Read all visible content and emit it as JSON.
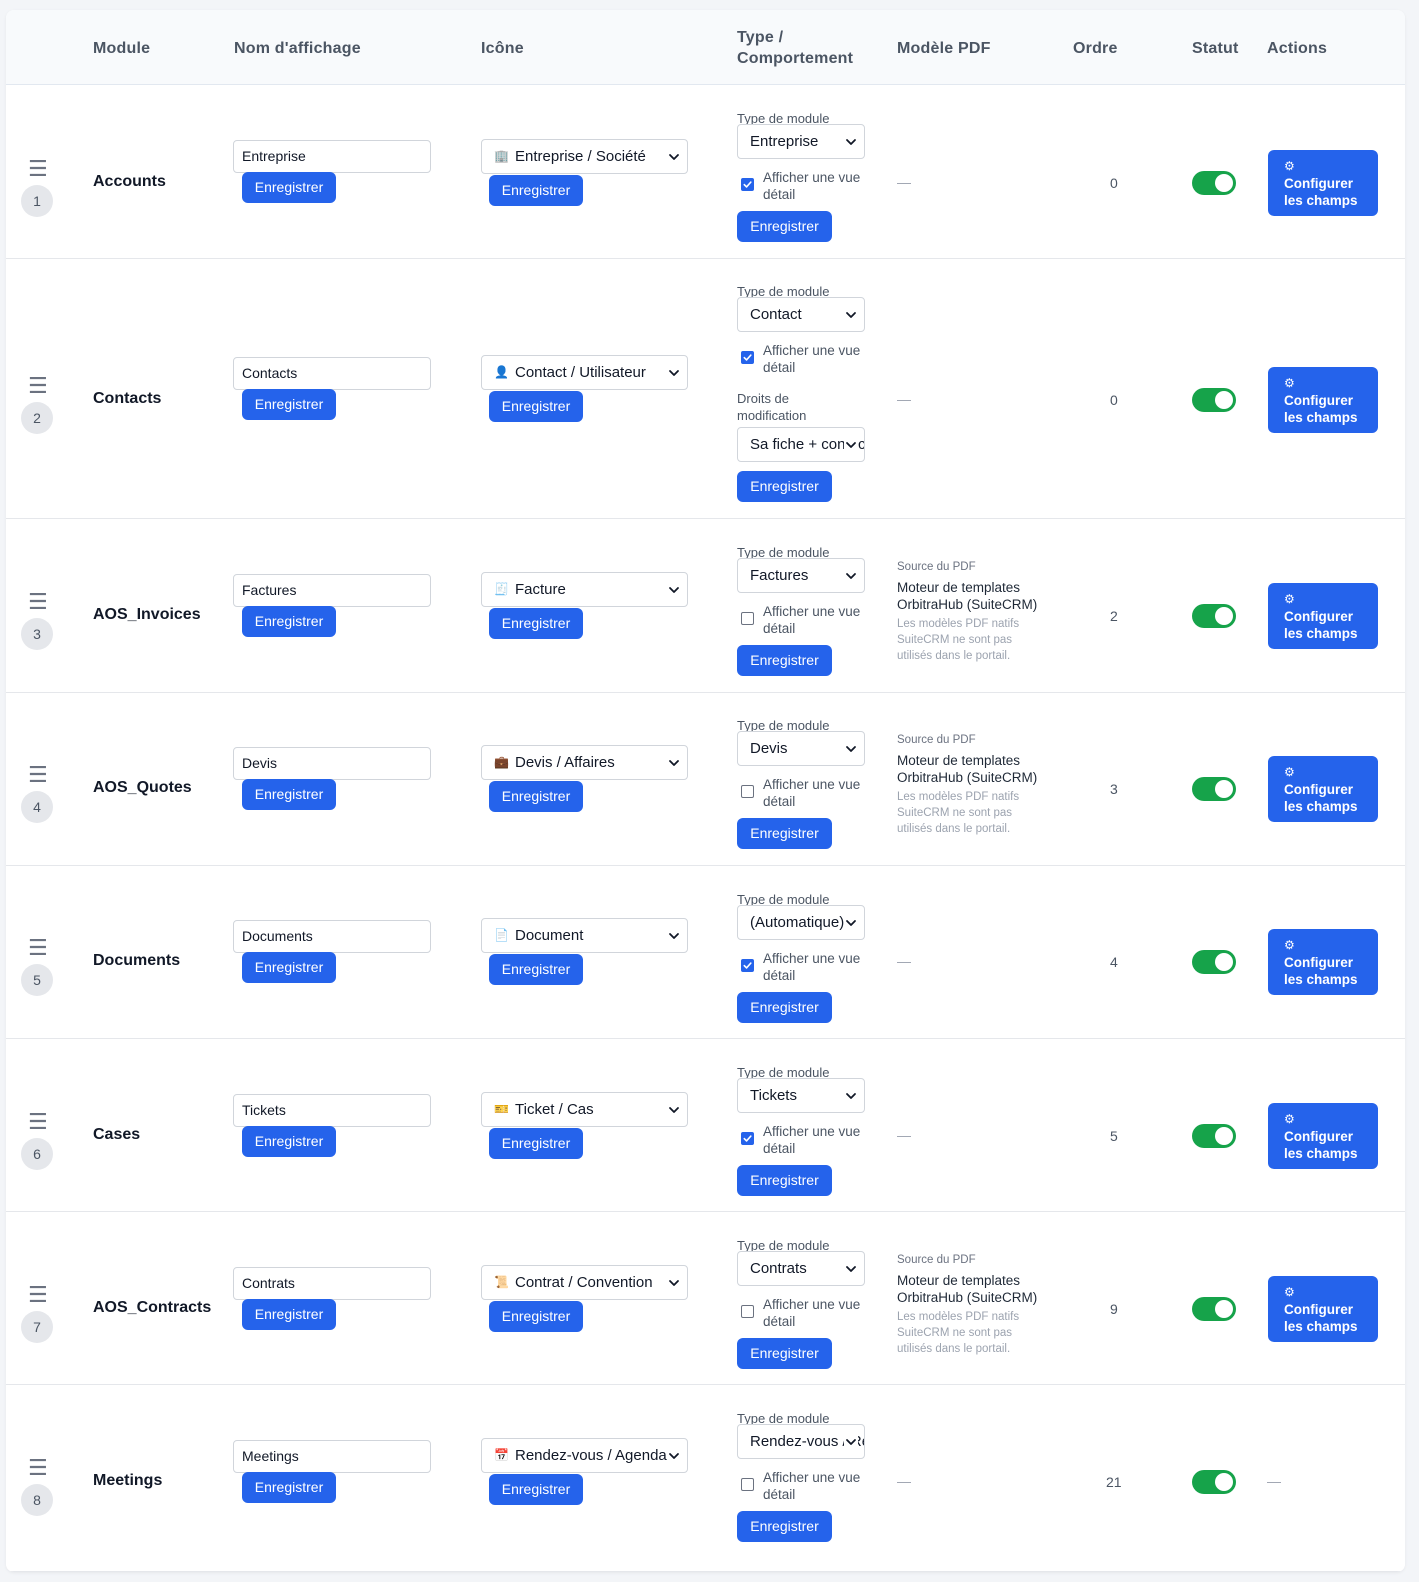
{
  "headers": {
    "module": "Module",
    "display_name": "Nom d'affichage",
    "icon": "Icône",
    "type_line1": "Type /",
    "type_line2": "Comportement",
    "pdf": "Modèle PDF",
    "order": "Ordre",
    "status": "Statut",
    "actions": "Actions"
  },
  "common": {
    "save": "Enregistrer",
    "module_type_label": "Type de module",
    "detail_line1": "Afficher une vue",
    "detail_line2": "détail",
    "edit_rights_line1": "Droits de",
    "edit_rights_line2": "modification",
    "configure_line1": "Configurer",
    "configure_line2": "les champs",
    "gear": "⚙",
    "dash": "—",
    "pdf_source": "Source du PDF",
    "pdf_engine_line1": "Moteur de templates",
    "pdf_engine_line2": "OrbitraHub (SuiteCRM)",
    "pdf_note_line1": "Les modèles PDF natifs",
    "pdf_note_line2": "SuiteCRM ne sont pas",
    "pdf_note_line3": "utilisés dans le portail."
  },
  "rows": [
    {
      "position": "1",
      "module": "Accounts",
      "display_name": "Entreprise",
      "icon_glyph": "🏢",
      "icon_label": "Entreprise / Société",
      "module_type": "Entreprise",
      "detail_view": true,
      "order": "0",
      "status": "on"
    },
    {
      "position": "2",
      "module": "Contacts",
      "display_name": "Contacts",
      "icon_glyph": "👤",
      "icon_label": "Contact / Utilisateur",
      "module_type": "Contact",
      "detail_view": true,
      "edit_rights": "Sa fiche + contact",
      "order": "0",
      "status": "on"
    },
    {
      "position": "3",
      "module": "AOS_Invoices",
      "display_name": "Factures",
      "icon_glyph": "🧾",
      "icon_label": "Facture",
      "module_type": "Factures",
      "detail_view": false,
      "order": "2",
      "status": "on"
    },
    {
      "position": "4",
      "module": "AOS_Quotes",
      "display_name": "Devis",
      "icon_glyph": "💼",
      "icon_label": "Devis / Affaires",
      "module_type": "Devis",
      "detail_view": false,
      "order": "3",
      "status": "on"
    },
    {
      "position": "5",
      "module": "Documents",
      "display_name": "Documents",
      "icon_glyph": "📄",
      "icon_label": "Document",
      "module_type": "(Automatique)",
      "detail_view": true,
      "order": "4",
      "status": "on"
    },
    {
      "position": "6",
      "module": "Cases",
      "display_name": "Tickets",
      "icon_glyph": "🎫",
      "icon_label": "Ticket / Cas",
      "module_type": "Tickets",
      "detail_view": true,
      "order": "5",
      "status": "on"
    },
    {
      "position": "7",
      "module": "AOS_Contracts",
      "display_name": "Contrats",
      "icon_glyph": "📜",
      "icon_label": "Contrat / Convention",
      "module_type": "Contrats",
      "detail_view": false,
      "order": "9",
      "status": "on"
    },
    {
      "position": "8",
      "module": "Meetings",
      "display_name": "Meetings",
      "icon_glyph": "📅",
      "icon_label": "Rendez-vous / Agenda",
      "module_type": "Rendez-vous / Réunion",
      "detail_view": false,
      "order": "21",
      "status": "on"
    }
  ],
  "colors": {
    "primary": "#2563eb",
    "toggle_on": "#16a34a",
    "checkbox_checked": "#2563eb",
    "header_bg": "#f8fafc"
  }
}
